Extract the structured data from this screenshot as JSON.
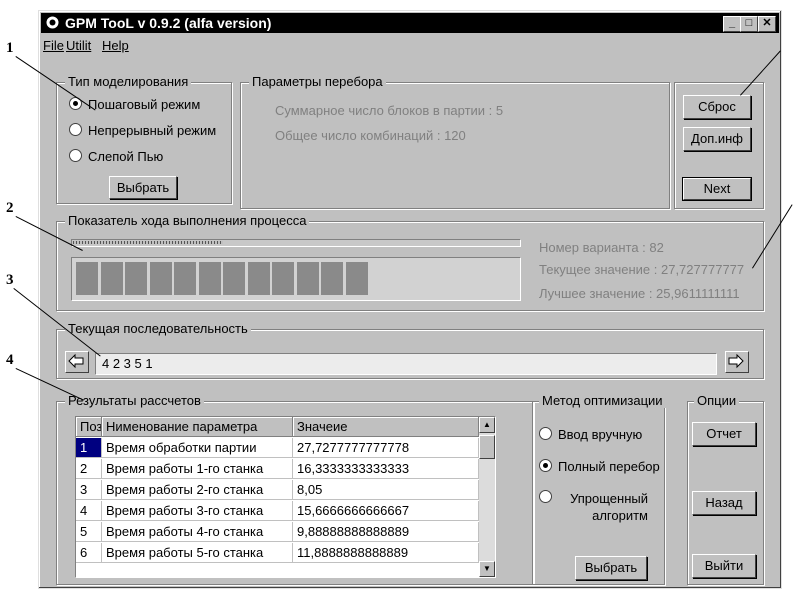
{
  "window": {
    "title": "GPM TooL v 0.9.2 (alfa version)"
  },
  "menu": {
    "file": "File",
    "utilit": "Utilit",
    "help": "Help"
  },
  "callouts": [
    "1",
    "2",
    "3",
    "4"
  ],
  "modeling": {
    "label": "Тип моделирования",
    "options": [
      "Пошаговый режим",
      "Непрерывный режим",
      "Слепой Пью"
    ],
    "selected": 0,
    "button": "Выбрать"
  },
  "params": {
    "label": "Параметры перебора",
    "total_blocks": "Суммарное число блоков в партии : 5",
    "total_combinations": "Общее число комбинаций : 120"
  },
  "right_buttons": {
    "reset": "Сброс",
    "more_info": "Доп.инф",
    "next": "Next"
  },
  "progress": {
    "label": "Показатель хода выполнения процесса",
    "variant_number": "Номер варианта   : 82",
    "current_value": "Текущее значение : 27,727777777",
    "best_value": "Лучшее значение   : 25,9611111111",
    "filled_blocks": 12,
    "total_blocks": 19
  },
  "sequence": {
    "label": "Текущая последовательность",
    "value": "4  2  3  5  1"
  },
  "results": {
    "label": "Результаты рассчетов",
    "columns": [
      "Поз",
      "Нименование параметра",
      "Значеие"
    ],
    "rows": [
      [
        "1",
        "Время обработки партии",
        "27,7277777777778"
      ],
      [
        "2",
        "Время работы 1-го станка",
        "16,3333333333333"
      ],
      [
        "3",
        "Время работы 2-го станка",
        "8,05"
      ],
      [
        "4",
        "Время работы 3-го станка",
        "15,6666666666667"
      ],
      [
        "5",
        "Время работы 4-го станка",
        "9,88888888888889"
      ],
      [
        "6",
        "Время работы 5-го станка",
        "11,8888888888889"
      ]
    ]
  },
  "method": {
    "label": "Метод оптимизации",
    "options": [
      "Ввод вручную",
      "Полный перебор",
      "Упрощенный алгоритм"
    ],
    "selected": 1,
    "button": "Выбрать"
  },
  "options": {
    "label": "Опции",
    "report": "Отчет",
    "back": "Назад",
    "exit": "Выйти"
  }
}
